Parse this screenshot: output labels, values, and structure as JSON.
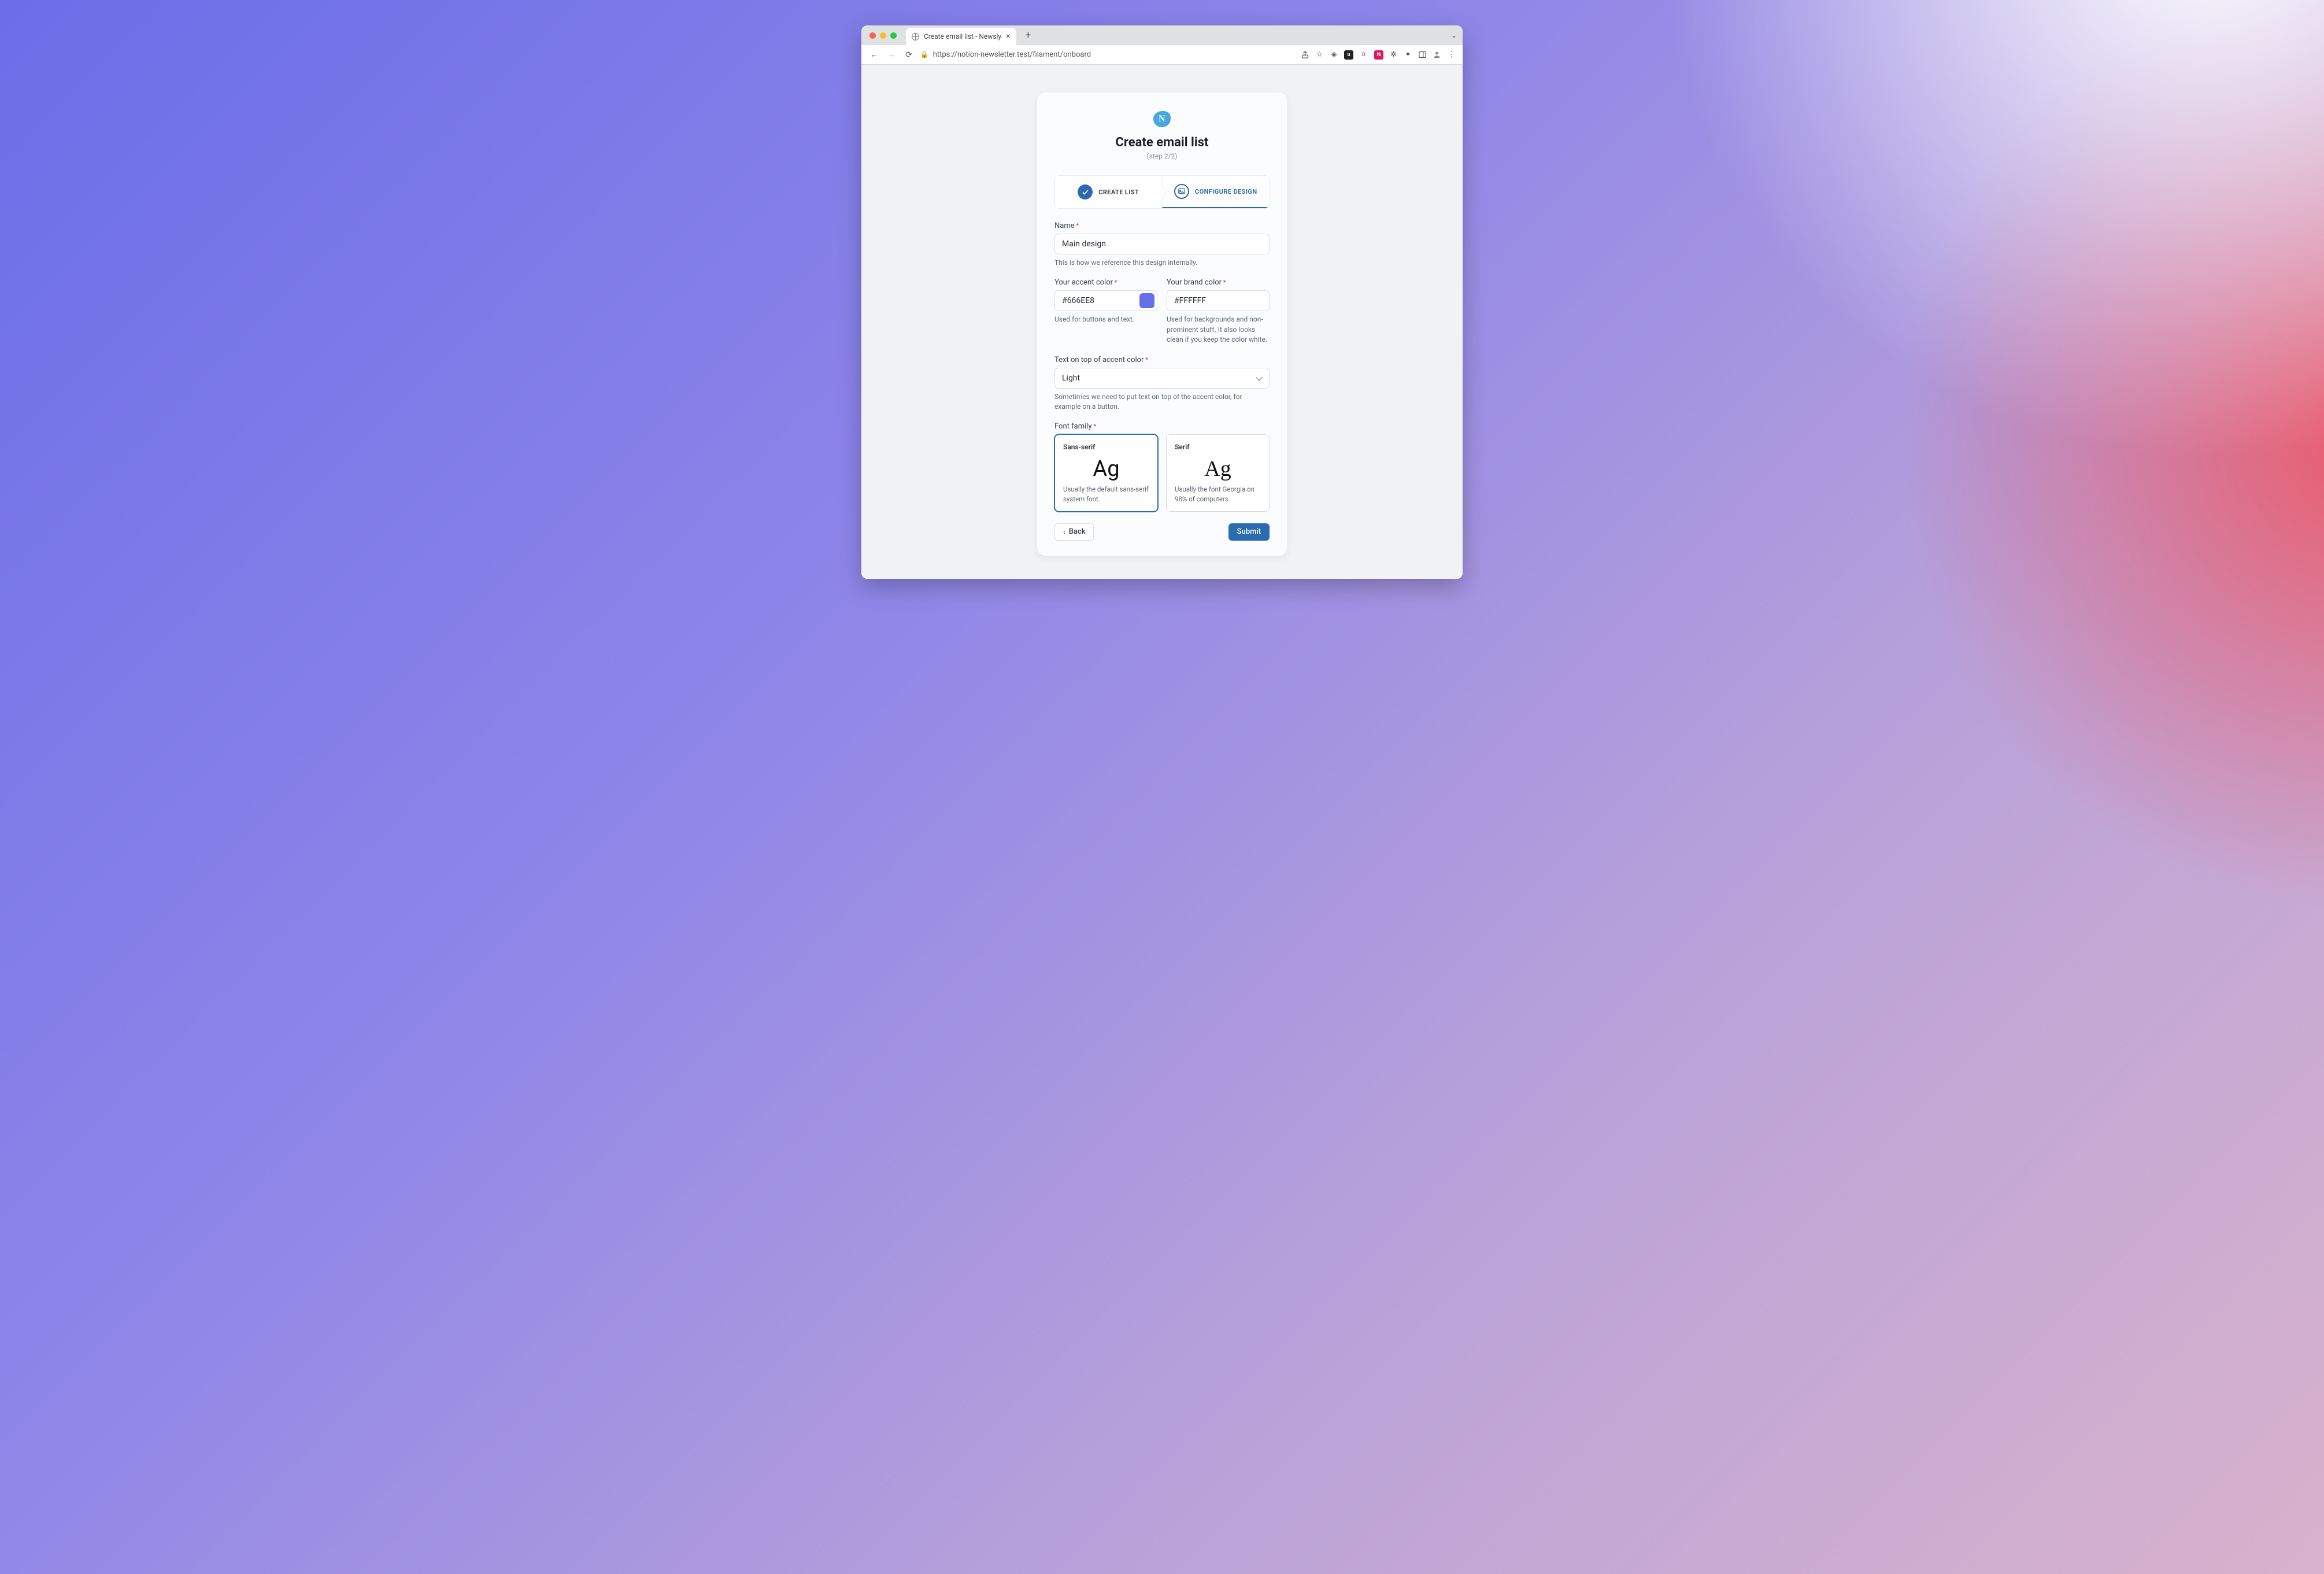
{
  "browser": {
    "tab_title": "Create email list - Newsly",
    "url": "https://notion-newsletter.test/filament/onboard"
  },
  "header": {
    "logo_letter": "N",
    "title": "Create email list",
    "step_indicator": "(step 2/2)"
  },
  "stepper": {
    "step1_label": "CREATE LIST",
    "step2_label": "CONFIGURE DESIGN"
  },
  "fields": {
    "name": {
      "label": "Name",
      "value": "Main design",
      "help": "This is how we reference this design internally."
    },
    "accent_color": {
      "label": "Your accent color",
      "value": "#666EE8",
      "swatch": "#666EE8",
      "help": "Used for buttons and text."
    },
    "brand_color": {
      "label": "Your brand color",
      "value": "#FFFFFF",
      "help": "Used for backgrounds and non-prominent stuff. It also looks clean if you keep the color white."
    },
    "text_on_accent": {
      "label": "Text on top of accent color",
      "value": "Light",
      "help": "Sometimes we need to put text on top of the accent color, for example on a button."
    },
    "font_family": {
      "label": "Font family",
      "options": [
        {
          "id": "sans",
          "name": "Sans-serif",
          "sample": "Ag",
          "desc": "Usually the default sans-serif system font.",
          "selected": true
        },
        {
          "id": "serif",
          "name": "Serif",
          "sample": "Ag",
          "desc": "Usually the font Georgia on 98% of computers.",
          "selected": false
        }
      ]
    }
  },
  "actions": {
    "back": "Back",
    "submit": "Submit"
  }
}
